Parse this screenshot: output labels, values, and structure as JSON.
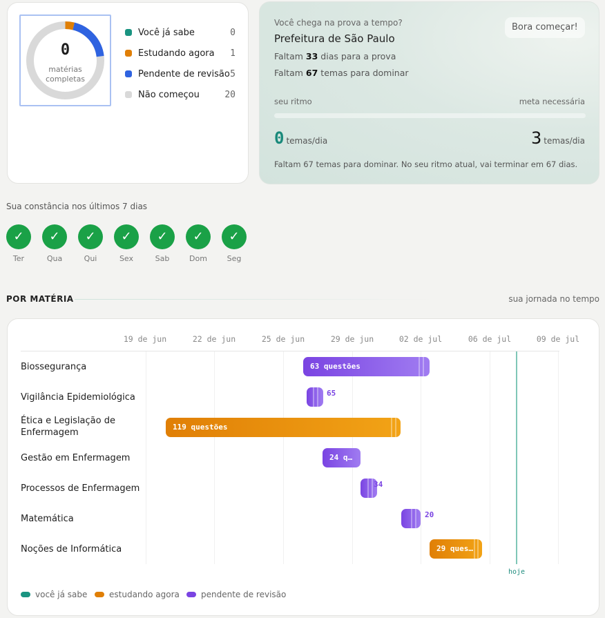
{
  "status_card": {
    "completed_count": "0",
    "completed_caption_1": "matérias",
    "completed_caption_2": "completas",
    "legend": [
      {
        "label": "Você já sabe",
        "count": "0",
        "color": "#1a9481"
      },
      {
        "label": "Estudando agora",
        "count": "1",
        "color": "#e07f06"
      },
      {
        "label": "Pendente de revisão",
        "count": "5",
        "color": "#2f63e0"
      },
      {
        "label": "Não começou",
        "count": "20",
        "color": "#d9d9d9"
      }
    ],
    "donut_fractions": {
      "known": 0,
      "studying": 0.0385,
      "pending": 0.1923,
      "not_started": 0.7692
    }
  },
  "pace_card": {
    "question": "Você chega na prova a tempo?",
    "start_button": "Bora começar!",
    "exam_name": "Prefeitura de São Paulo",
    "days_prefix": "Faltam",
    "days_value": "33",
    "days_suffix": "dias para a prova",
    "topics_prefix": "Faltam",
    "topics_value": "67",
    "topics_suffix": "temas para dominar",
    "rhythm_label": "seu ritmo",
    "goal_label": "meta necessária",
    "current_rate": "0",
    "needed_rate": "3",
    "rate_unit": "temas/dia",
    "summary": "Faltam 67 temas para dominar. No seu ritmo atual, vai terminar em 67 dias."
  },
  "streak": {
    "title": "Sua constância nos últimos 7 dias",
    "check_glyph": "✓",
    "days": [
      "Ter",
      "Qua",
      "Qui",
      "Sex",
      "Sab",
      "Dom",
      "Seg"
    ]
  },
  "section": {
    "title": "POR MATÉRIA",
    "right_label": "sua jornada no tempo"
  },
  "gantt": {
    "ticks": [
      "19 de jun",
      "22 de jun",
      "25 de jun",
      "29 de jun",
      "02 de jul",
      "06 de jul",
      "09 de jul"
    ],
    "today_label": "hoje",
    "rows": [
      {
        "label": "Biossegurança",
        "bar_text": "63 questões",
        "outside_text": "",
        "status": "purple"
      },
      {
        "label": "Vigilância Epidemiológica",
        "bar_text": "",
        "outside_text": "65",
        "status": "purple"
      },
      {
        "label": "Ética e Legislação de Enfermagem",
        "bar_text": "119 questões",
        "outside_text": "",
        "status": "orange"
      },
      {
        "label": "Gestão em Enfermagem",
        "bar_text": "24 q…",
        "outside_text": "",
        "status": "purple"
      },
      {
        "label": "Processos de Enfermagem",
        "bar_text": "",
        "outside_text": "34",
        "status": "purple"
      },
      {
        "label": "Matemática",
        "bar_text": "",
        "outside_text": "20",
        "status": "purple"
      },
      {
        "label": "Noções de Informática",
        "bar_text": "29 ques…",
        "outside_text": "",
        "status": "orange"
      }
    ],
    "legend": [
      {
        "label": "você já sabe",
        "color": "#1a9481"
      },
      {
        "label": "estudando agora",
        "color": "#e07f06"
      },
      {
        "label": "pendente de revisão",
        "color": "#7a44e2"
      }
    ]
  }
}
